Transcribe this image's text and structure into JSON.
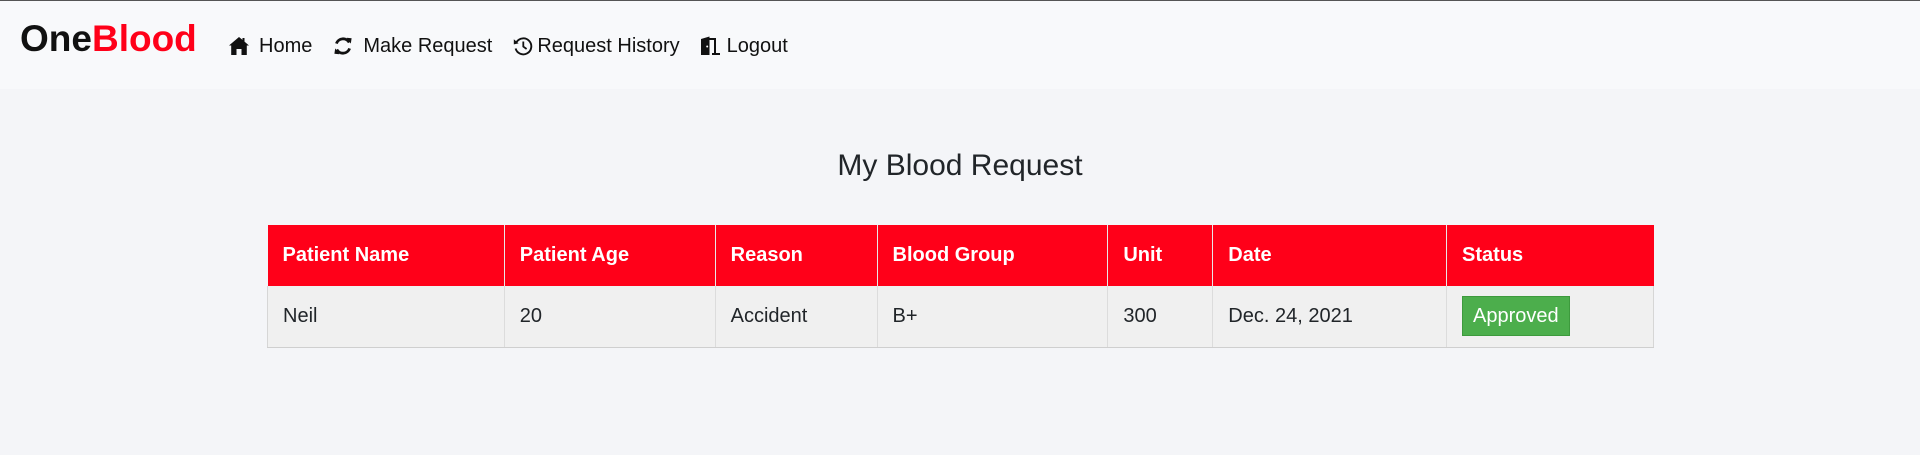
{
  "brand": {
    "part1": "One",
    "part2": "Blood",
    "accent_color": "#ff0019"
  },
  "nav": {
    "items": [
      {
        "label": "Home",
        "icon": "home-icon"
      },
      {
        "label": "Make Request",
        "icon": "refresh-icon"
      },
      {
        "label": "Request History",
        "icon": "history-icon"
      },
      {
        "label": "Logout",
        "icon": "door-exit-icon"
      }
    ]
  },
  "page": {
    "title": "My Blood Request"
  },
  "table": {
    "headers": [
      "Patient Name",
      "Patient Age",
      "Reason",
      "Blood Group",
      "Unit",
      "Date",
      "Status"
    ],
    "rows": [
      {
        "patient_name": "Neil",
        "patient_age": "20",
        "reason": "Accident",
        "blood_group": "B+",
        "unit": "300",
        "date": "Dec. 24, 2021",
        "status": "Approved",
        "status_color": "#4cae4c"
      }
    ],
    "header_color": "#ff0019"
  }
}
